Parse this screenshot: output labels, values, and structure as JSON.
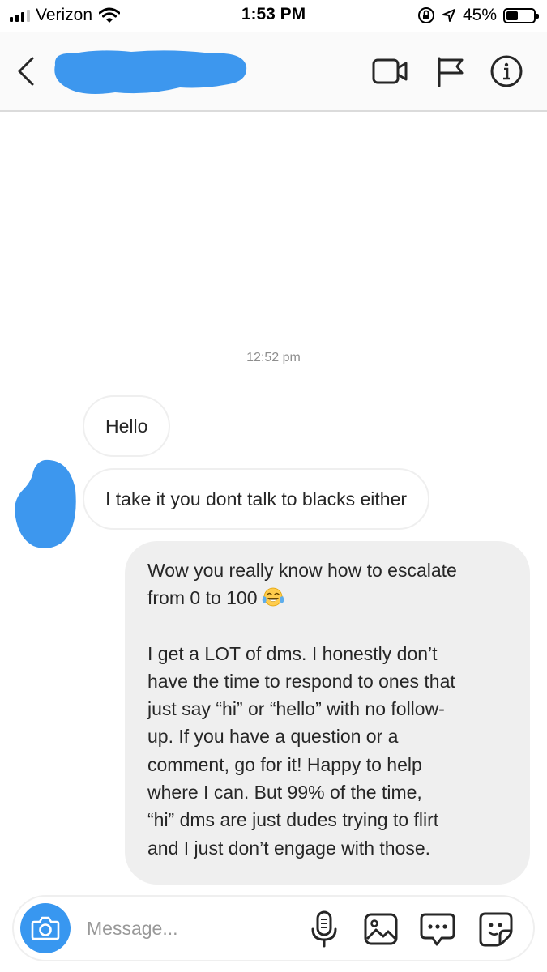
{
  "status_bar": {
    "carrier": "Verizon",
    "time": "1:53 PM",
    "battery_percent": "45%",
    "battery_level": 0.45,
    "icons": [
      "signal-icon",
      "wifi-icon",
      "orientation-lock-icon",
      "location-icon",
      "battery-icon"
    ]
  },
  "header": {
    "icons": [
      "back-chevron-icon",
      "video-call-icon",
      "flag-icon",
      "info-icon"
    ]
  },
  "thread": {
    "timestamp": "12:52 pm",
    "incoming": [
      "Hello",
      "I take it you dont talk to blacks either"
    ],
    "outgoing": {
      "para1_lines": [
        "Wow you really know how to escalate",
        "from 0 to 100"
      ],
      "para1_emoji": "face-with-tears-of-joy",
      "para2_lines": [
        "I get a LOT of dms. I honestly don’t",
        "have the time to respond to ones that",
        "just say “hi” or “hello” with no follow-",
        "up. If you have a question or a",
        "comment, go for it! Happy to help",
        "where I can. But 99% of the time,",
        "“hi” dms are just dudes trying to flirt",
        "and I just don’t engage with those."
      ]
    }
  },
  "composer": {
    "placeholder": "Message...",
    "icons": [
      "camera-icon",
      "microphone-icon",
      "gallery-icon",
      "chat-bubble-icon",
      "sticker-icon"
    ]
  },
  "colors": {
    "accent": "#3897f0",
    "redaction": "#3d97ee",
    "incoming_border": "#efefef",
    "outgoing_bg": "#efefef",
    "header_bg": "#fafafa",
    "timestamp": "#8e8e8e"
  }
}
